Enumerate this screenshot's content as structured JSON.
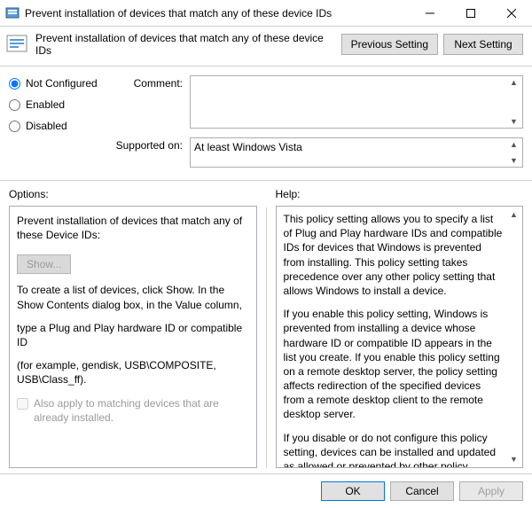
{
  "window": {
    "title": "Prevent installation of devices that match any of these device IDs"
  },
  "subheader": {
    "title": "Prevent installation of devices that match any of these device IDs",
    "prev": "Previous Setting",
    "next": "Next Setting"
  },
  "state": {
    "not_configured": "Not Configured",
    "enabled": "Enabled",
    "disabled": "Disabled"
  },
  "comment": {
    "label": "Comment:"
  },
  "supported": {
    "label": "Supported on:",
    "value": "At least Windows Vista"
  },
  "options": {
    "header": "Options:",
    "intro": "Prevent installation of devices that match any of these Device IDs:",
    "show": "Show...",
    "hint1": "To create a list of devices, click Show. In the Show Contents dialog box, in the Value column,",
    "hint2": "type a Plug and Play hardware ID or compatible ID",
    "hint3": "(for example, gendisk, USB\\COMPOSITE, USB\\Class_ff).",
    "also_apply": "Also apply to matching devices that are already installed."
  },
  "help": {
    "header": "Help:",
    "p1": "This policy setting allows you to specify a list of Plug and Play hardware IDs and compatible IDs for devices that Windows is prevented from installing. This policy setting takes precedence over any other policy setting that allows Windows to install a device.",
    "p2": "If you enable this policy setting, Windows is prevented from installing a device whose hardware ID or compatible ID appears in the list you create. If you enable this policy setting on a remote desktop server, the policy setting affects redirection of the specified devices from a remote desktop client to the remote desktop server.",
    "p3": "If you disable or do not configure this policy setting, devices can be installed and updated as allowed or prevented by other policy settings."
  },
  "footer": {
    "ok": "OK",
    "cancel": "Cancel",
    "apply": "Apply"
  }
}
